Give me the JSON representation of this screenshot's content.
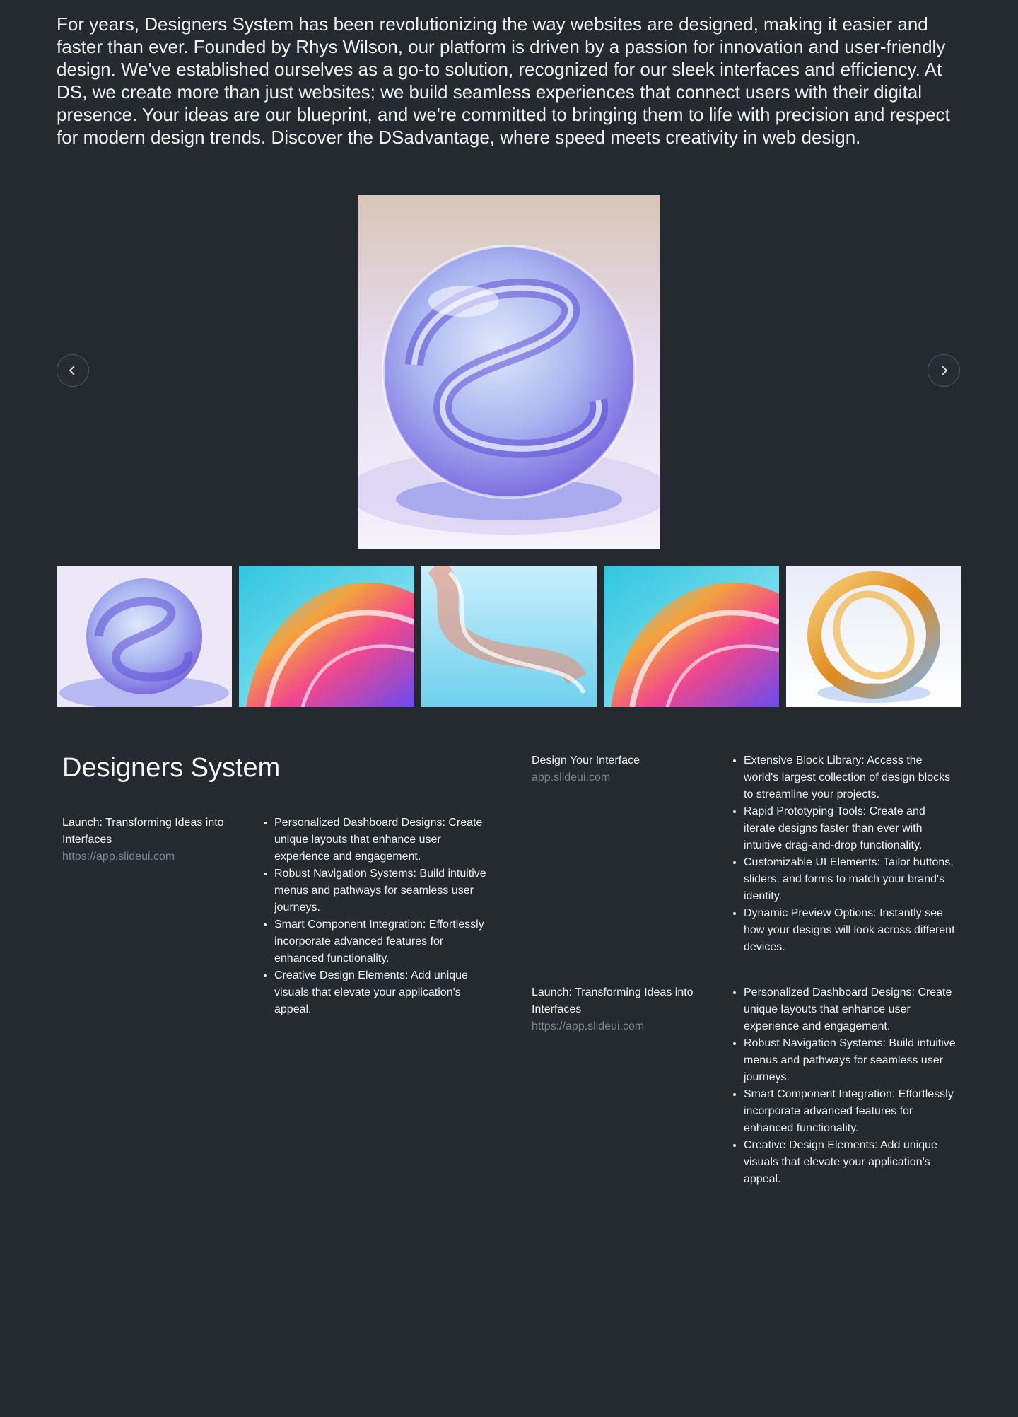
{
  "intro": {
    "text": "For years, Designers System has been revolutionizing the way websites are designed, making it easier and faster than ever. Founded by Rhys Wilson, our platform is driven by a passion for innovation and user-friendly design. We've established ourselves as a go-to solution, recognized for our sleek interfaces and efficiency. At DS, we create more than just websites; we build seamless experiences that connect users with their digital presence. Your ideas are our blueprint, and we're committed to bringing them to life with precision and respect for modern design trends. Discover the DSadvantage, where speed meets creativity in web design."
  },
  "carousel": {
    "prev_icon": "chevron-left-icon",
    "next_icon": "chevron-right-icon",
    "hero_image": "glass-sphere-render",
    "thumbnails": [
      "glass-sphere-render",
      "rainbow-swirl-render",
      "glass-ribbon-render",
      "rainbow-swirl-render",
      "glass-ring-render"
    ]
  },
  "brand": {
    "title": "Designers System"
  },
  "projects": [
    {
      "title": "Launch: Transforming Ideas into Interfaces",
      "url": "https://app.slideui.com",
      "features": [
        "Personalized Dashboard Designs: Create unique layouts that enhance user experience and engagement.",
        "Robust Navigation Systems: Build intuitive menus and pathways for seamless user journeys.",
        "Smart Component Integration: Effortlessly incorporate advanced features for enhanced functionality.",
        "Creative Design Elements: Add unique visuals that elevate your application's appeal."
      ]
    },
    {
      "title": "Design Your Interface",
      "url": "app.slideui.com",
      "features": [
        "Extensive Block Library: Access the world's largest collection of design blocks to streamline your projects.",
        "Rapid Prototyping Tools: Create and iterate designs faster than ever with intuitive drag-and-drop functionality.",
        "Customizable UI Elements: Tailor buttons, sliders, and forms to match your brand's identity.",
        "Dynamic Preview Options: Instantly see how your designs will look across different devices."
      ]
    },
    {
      "title": "Launch: Transforming Ideas into Interfaces",
      "url": "https://app.slideui.com",
      "features": [
        "Personalized Dashboard Designs: Create unique layouts that enhance user experience and engagement.",
        "Robust Navigation Systems: Build intuitive menus and pathways for seamless user journeys.",
        "Smart Component Integration: Effortlessly incorporate advanced features for enhanced functionality.",
        "Creative Design Elements: Add unique visuals that elevate your application's appeal."
      ]
    }
  ],
  "colors": {
    "background": "#252a30",
    "text": "#eef0f2",
    "muted_link": "#7d858e",
    "accent_violet": "#8a78e8"
  }
}
